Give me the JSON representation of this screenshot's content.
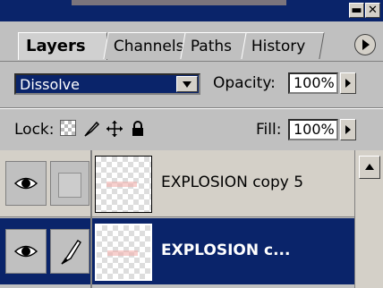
{
  "window": {
    "minimize_glyph": "▬",
    "close_glyph": "✕"
  },
  "tabs": [
    {
      "label": "Layers",
      "active": true
    },
    {
      "label": "Channels",
      "active": false
    },
    {
      "label": "Paths",
      "active": false
    },
    {
      "label": "History",
      "active": false
    }
  ],
  "blend": {
    "mode": "Dissolve",
    "opacity_label": "Opacity:",
    "opacity_value": "100%"
  },
  "lock": {
    "label": "Lock:",
    "fill_label": "Fill:",
    "fill_value": "100%",
    "icons": [
      "lock-transparent-icon",
      "lock-brush-icon",
      "lock-move-icon",
      "lock-all-icon"
    ]
  },
  "layers": [
    {
      "name": "EXPLOSION copy 5",
      "selected": false,
      "visible": true
    },
    {
      "name": "EXPLOSION c...",
      "selected": true,
      "visible": true
    }
  ],
  "colors": {
    "titlebar": "#0a246a",
    "selection": "#0a246a",
    "panel": "#c0c0c0"
  }
}
